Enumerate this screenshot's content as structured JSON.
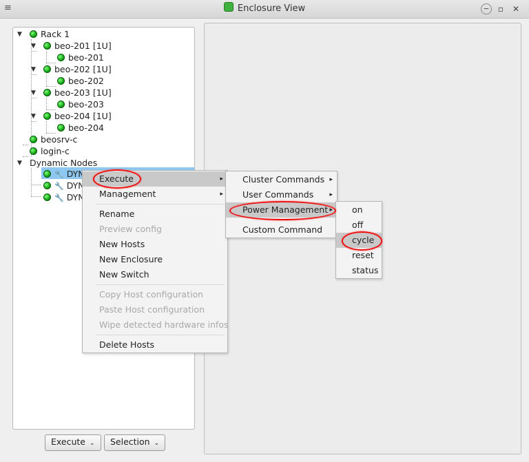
{
  "window": {
    "title": "Enclosure View"
  },
  "tree": {
    "nodes": [
      {
        "label": "Rack 1"
      },
      {
        "label": "beo-201 [1U]"
      },
      {
        "label": "beo-201"
      },
      {
        "label": "beo-202 [1U]"
      },
      {
        "label": "beo-202"
      },
      {
        "label": "beo-203 [1U]"
      },
      {
        "label": "beo-203"
      },
      {
        "label": "beo-204 [1U]"
      },
      {
        "label": "beo-204"
      },
      {
        "label": "beosrv-c"
      },
      {
        "label": "login-c"
      },
      {
        "label": "Dynamic Nodes"
      },
      {
        "label": "DYN-"
      },
      {
        "label": "DYN-"
      },
      {
        "label": "DYN-"
      }
    ]
  },
  "buttons": {
    "execute": "Execute",
    "selection": "Selection"
  },
  "context_menu": {
    "items": [
      "Execute",
      "Management",
      "Rename",
      "Preview config",
      "New Hosts",
      "New Enclosure",
      "New Switch",
      "Copy Host configuration",
      "Paste Host configuration",
      "Wipe detected hardware infos",
      "Delete Hosts"
    ]
  },
  "execute_menu": {
    "items": [
      "Cluster Commands",
      "User Commands",
      "Power Management",
      "Custom Command"
    ]
  },
  "power_menu": {
    "items": [
      "on",
      "off",
      "cycle",
      "reset",
      "status"
    ]
  },
  "colors": {
    "highlight_circle": "#ee1111",
    "selection": "#8ec7ef",
    "status_ok": "#14a814"
  }
}
